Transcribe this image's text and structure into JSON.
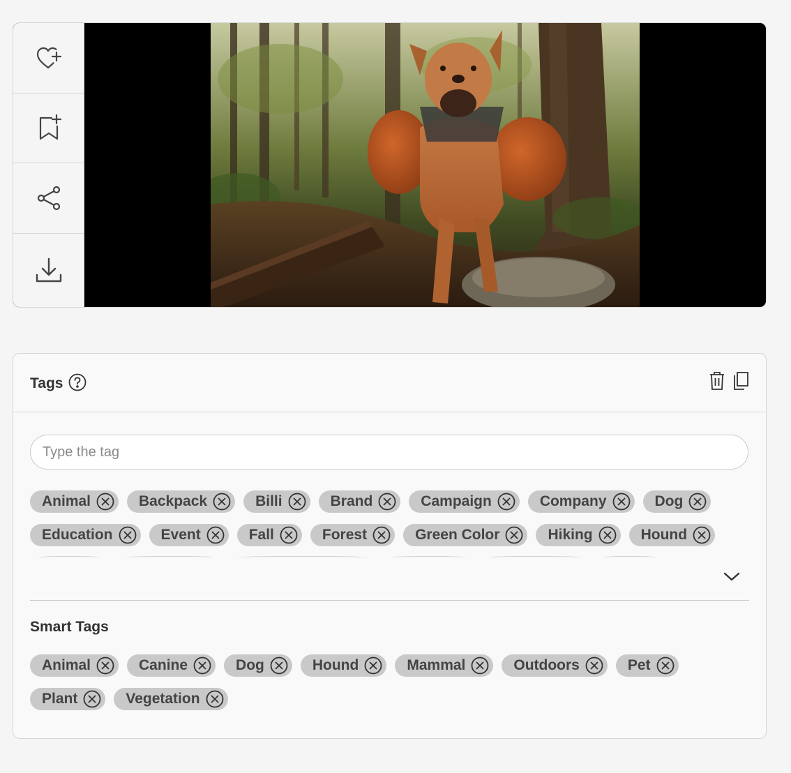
{
  "actions": [
    {
      "name": "favorite",
      "icon": "heart-plus-icon"
    },
    {
      "name": "add-to-collection",
      "icon": "bookmark-plus-icon"
    },
    {
      "name": "share",
      "icon": "share-icon"
    },
    {
      "name": "download",
      "icon": "download-icon"
    }
  ],
  "tags": {
    "title": "Tags",
    "input_placeholder": "Type the tag",
    "input_value": "",
    "rows": [
      [
        "Animal",
        "Backpack",
        "Billi",
        "Brand",
        "Campaign",
        "Company",
        "Dog"
      ],
      [
        "Education",
        "Event",
        "Fall",
        "Forest",
        "Green Color",
        "Hiking",
        "Hound"
      ]
    ]
  },
  "smart_tags": {
    "title": "Smart Tags",
    "rows": [
      [
        "Animal",
        "Canine",
        "Dog",
        "Hound",
        "Mammal",
        "Outdoors",
        "Pet"
      ],
      [
        "Plant",
        "Vegetation"
      ]
    ]
  },
  "colors": {
    "chip_bg": "#c9c9c9",
    "chip_text": "#444444",
    "border": "#d6d6d6"
  }
}
